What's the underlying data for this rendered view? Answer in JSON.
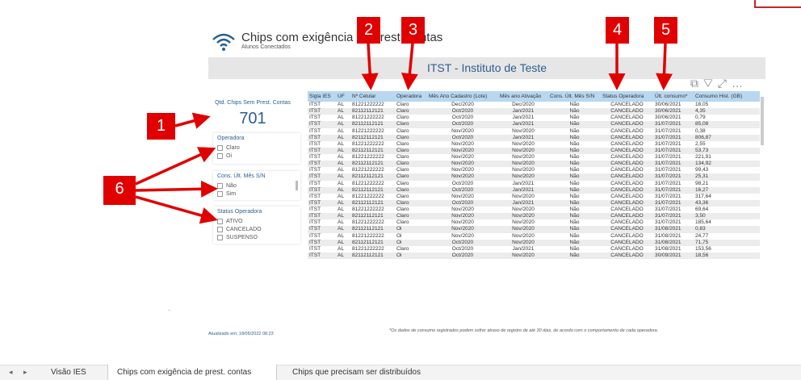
{
  "header": {
    "title": "Chips com exigência de prest. contas",
    "subtitle": "Alunos Conectados",
    "banner": "ITST - Instituto de Teste"
  },
  "kpi": {
    "label": "Qtd. Chips Sem Prest. Contas",
    "value": "701"
  },
  "slicers": {
    "operadora": {
      "title": "Operadora",
      "options": [
        "Claro",
        "Oi"
      ]
    },
    "cons": {
      "title": "Cons. Últ. Mês S/N",
      "options": [
        "Não",
        "Sim"
      ]
    },
    "status": {
      "title": "Status Operadora",
      "options": [
        "ATIVO",
        "CANCELADO",
        "SUSPENSO"
      ]
    }
  },
  "table": {
    "headers": [
      "Sigla IES",
      "UF",
      "Nº Celular",
      "Operadora",
      "Mês Ano Cadastro (Lote)",
      "Mês ano Ativação",
      "Cons. Últ. Mês S/N",
      "Status Operadora",
      "Últ. consumo*",
      "Consumo Hist. (GB)"
    ],
    "rows": [
      [
        "ITST",
        "AL",
        "81221222222",
        "Claro",
        "Dec/2020",
        "Dec/2020",
        "Não",
        "CANCELADO",
        "30/06/2021",
        "18,05"
      ],
      [
        "ITST",
        "AL",
        "82112112121",
        "Claro",
        "Oct/2020",
        "Jan/2021",
        "Não",
        "CANCELADO",
        "30/06/2021",
        "4,35"
      ],
      [
        "ITST",
        "AL",
        "81221222222",
        "Claro",
        "Oct/2020",
        "Jan/2021",
        "Não",
        "CANCELADO",
        "30/06/2021",
        "0,79"
      ],
      [
        "ITST",
        "AL",
        "82112112121",
        "Claro",
        "Oct/2020",
        "Jan/2021",
        "Não",
        "CANCELADO",
        "31/07/2021",
        "85,08"
      ],
      [
        "ITST",
        "AL",
        "81221222222",
        "Claro",
        "Nov/2020",
        "Nov/2020",
        "Não",
        "CANCELADO",
        "31/07/2021",
        "0,38"
      ],
      [
        "ITST",
        "AL",
        "82112112121",
        "Claro",
        "Oct/2020",
        "Jan/2021",
        "Não",
        "CANCELADO",
        "31/07/2021",
        "806,87"
      ],
      [
        "ITST",
        "AL",
        "81221222222",
        "Claro",
        "Nov/2020",
        "Nov/2020",
        "Não",
        "CANCELADO",
        "31/07/2021",
        "2,55"
      ],
      [
        "ITST",
        "AL",
        "82112112121",
        "Claro",
        "Nov/2020",
        "Nov/2020",
        "Não",
        "CANCELADO",
        "31/07/2021",
        "53,73"
      ],
      [
        "ITST",
        "AL",
        "81221222222",
        "Claro",
        "Nov/2020",
        "Nov/2020",
        "Não",
        "CANCELADO",
        "31/07/2021",
        "221,91"
      ],
      [
        "ITST",
        "AL",
        "82112112121",
        "Claro",
        "Nov/2020",
        "Nov/2020",
        "Não",
        "CANCELADO",
        "31/07/2021",
        "134,92"
      ],
      [
        "ITST",
        "AL",
        "81221222222",
        "Claro",
        "Nov/2020",
        "Nov/2020",
        "Não",
        "CANCELADO",
        "31/07/2021",
        "99,43"
      ],
      [
        "ITST",
        "AL",
        "82112112121",
        "Claro",
        "Nov/2020",
        "Nov/2020",
        "Não",
        "CANCELADO",
        "31/07/2021",
        "25,31"
      ],
      [
        "ITST",
        "AL",
        "81221222222",
        "Claro",
        "Oct/2020",
        "Jan/2021",
        "Não",
        "CANCELADO",
        "31/07/2021",
        "98,21"
      ],
      [
        "ITST",
        "AL",
        "82112112121",
        "Claro",
        "Oct/2020",
        "Jan/2021",
        "Não",
        "CANCELADO",
        "31/07/2021",
        "16,27"
      ],
      [
        "ITST",
        "AL",
        "81221222222",
        "Claro",
        "Nov/2020",
        "Nov/2020",
        "Não",
        "CANCELADO",
        "31/07/2021",
        "317,64"
      ],
      [
        "ITST",
        "AL",
        "82112112121",
        "Claro",
        "Oct/2020",
        "Jan/2021",
        "Não",
        "CANCELADO",
        "31/07/2021",
        "43,36"
      ],
      [
        "ITST",
        "AL",
        "81221222222",
        "Claro",
        "Nov/2020",
        "Nov/2020",
        "Não",
        "CANCELADO",
        "31/07/2021",
        "69,64"
      ],
      [
        "ITST",
        "AL",
        "82112112121",
        "Claro",
        "Nov/2020",
        "Nov/2020",
        "Não",
        "CANCELADO",
        "31/07/2021",
        "3,50"
      ],
      [
        "ITST",
        "AL",
        "81221222222",
        "Claro",
        "Nov/2020",
        "Nov/2020",
        "Não",
        "CANCELADO",
        "31/07/2021",
        "185,64"
      ],
      [
        "ITST",
        "AL",
        "82112112121",
        "Oi",
        "Nov/2020",
        "Nov/2020",
        "Não",
        "CANCELADO",
        "31/08/2021",
        "0,83"
      ],
      [
        "ITST",
        "AL",
        "81221222222",
        "Oi",
        "Nov/2020",
        "Nov/2020",
        "Não",
        "CANCELADO",
        "31/08/2021",
        "24,77"
      ],
      [
        "ITST",
        "AL",
        "82112112121",
        "Oi",
        "Oct/2020",
        "Nov/2020",
        "Não",
        "CANCELADO",
        "31/08/2021",
        "71,75"
      ],
      [
        "ITST",
        "AL",
        "81221222222",
        "Claro",
        "Oct/2020",
        "Jan/2021",
        "Não",
        "CANCELADO",
        "31/08/2021",
        "153,56"
      ],
      [
        "ITST",
        "AL",
        "82112112121",
        "Oi",
        "Oct/2020",
        "Nov/2020",
        "Não",
        "CANCELADO",
        "30/09/2021",
        "18,56"
      ]
    ]
  },
  "footer": {
    "updated": "Atualizado em: 18/05/2022 08:23",
    "note": "*Os dados de consumo registrados podem sofrer atraso de registro de até 30 dias, de acordo com o comportamento de cada operadora."
  },
  "tabs": [
    "Visão IES",
    "Chips com exigência de prest. contas",
    "Chips que precisam ser distribuídos"
  ],
  "badges": [
    "1",
    "2",
    "3",
    "4",
    "5",
    "6"
  ],
  "colors": {
    "accent": "#2d5f8e",
    "header_bg": "#b8d7f0",
    "badge": "#e00000"
  }
}
